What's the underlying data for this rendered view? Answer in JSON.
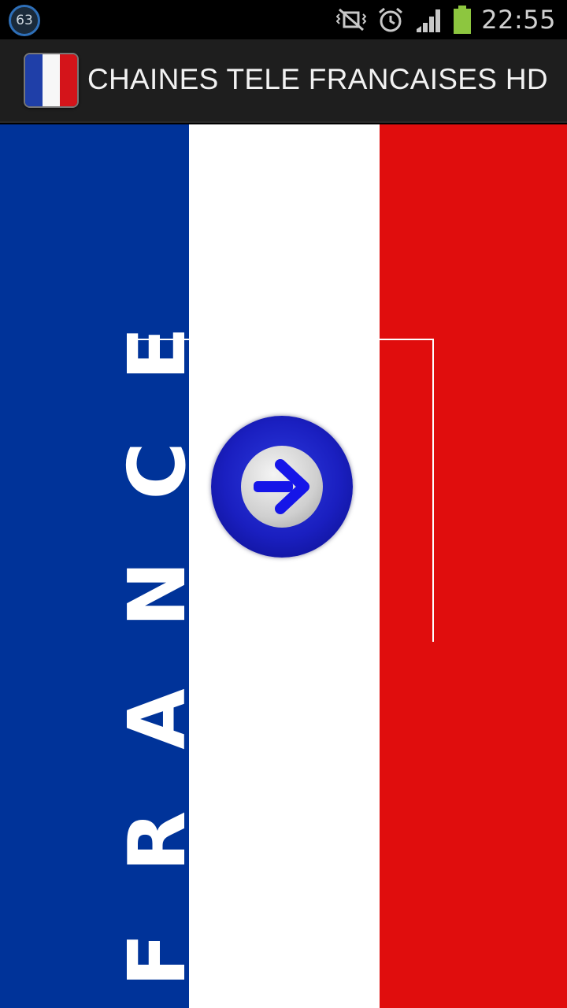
{
  "status_bar": {
    "notification_count": "63",
    "time": "22:55",
    "icons": [
      "no-signal-vibrate-icon",
      "alarm-icon",
      "signal-bars-icon",
      "battery-icon"
    ],
    "battery_color": "#8dc63f"
  },
  "action_bar": {
    "title": "CHAINES TELE FRANCAISES HD",
    "icon": "app-flag-icon"
  },
  "content": {
    "flag_word": "FRANCE",
    "colors": {
      "blue": "#003399",
      "white": "#ffffff",
      "red": "#e00d0d"
    },
    "go_button_icon": "arrow-right-icon"
  }
}
